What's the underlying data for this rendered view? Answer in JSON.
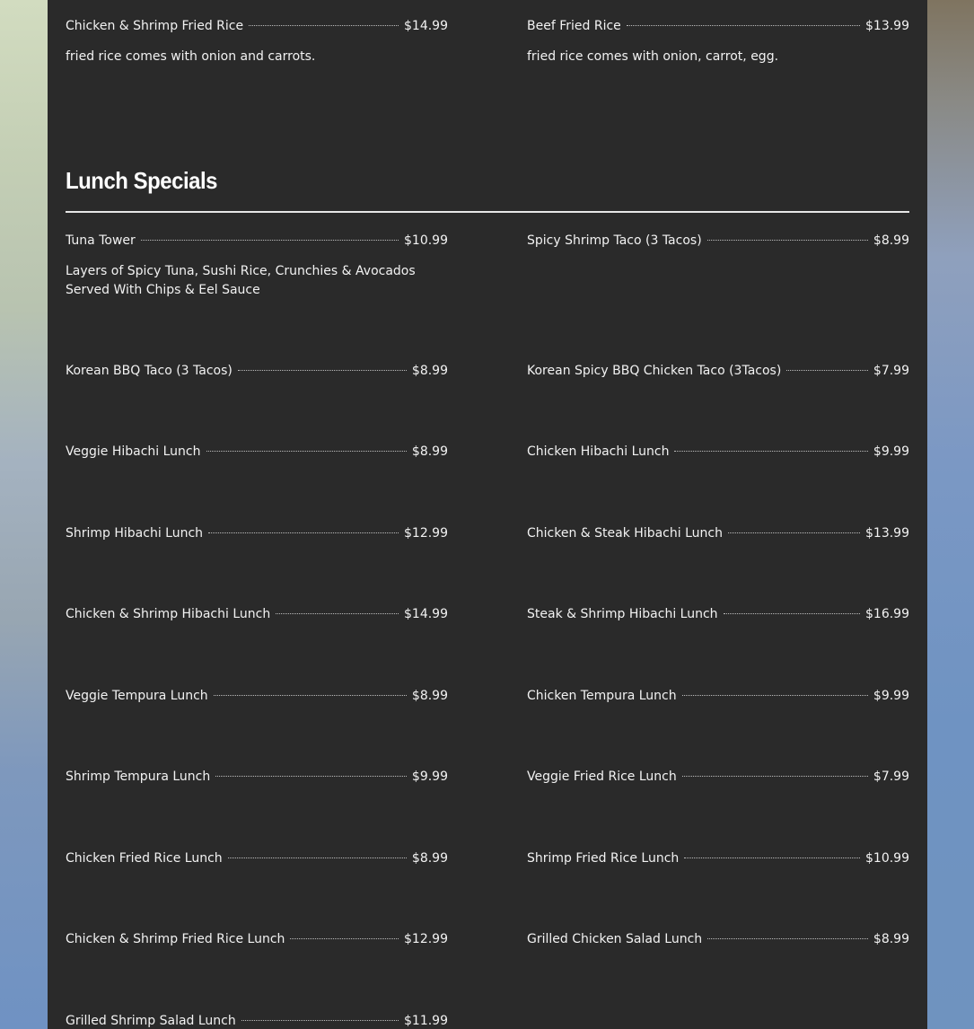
{
  "top_items": [
    {
      "name": "Chicken & Shrimp Fried Rice",
      "price": "$14.99",
      "desc": "fried rice comes with onion and carrots."
    },
    {
      "name": "Beef Fried Rice",
      "price": "$13.99",
      "desc": "fried rice comes with onion, carrot, egg."
    }
  ],
  "section": {
    "title": "Lunch Specials"
  },
  "lunch": [
    {
      "name": "Tuna Tower",
      "price": "$10.99",
      "desc": "Layers of Spicy Tuna, Sushi Rice, Crunchies & Avocados Served With Chips & Eel Sauce"
    },
    {
      "name": "Spicy Shrimp Taco (3 Tacos)",
      "price": "$8.99"
    },
    {
      "name": "Korean BBQ Taco (3 Tacos)",
      "price": "$8.99"
    },
    {
      "name": "Korean Spicy BBQ Chicken Taco (3Tacos)",
      "price": "$7.99"
    },
    {
      "name": "Veggie Hibachi Lunch",
      "price": "$8.99"
    },
    {
      "name": "Chicken Hibachi Lunch",
      "price": "$9.99"
    },
    {
      "name": "Shrimp Hibachi Lunch",
      "price": "$12.99"
    },
    {
      "name": "Chicken & Steak Hibachi Lunch",
      "price": "$13.99"
    },
    {
      "name": "Chicken & Shrimp Hibachi Lunch",
      "price": "$14.99"
    },
    {
      "name": "Steak & Shrimp Hibachi Lunch",
      "price": "$16.99"
    },
    {
      "name": "Veggie Tempura Lunch",
      "price": "$8.99"
    },
    {
      "name": "Chicken Tempura Lunch",
      "price": "$9.99"
    },
    {
      "name": "Shrimp Tempura Lunch",
      "price": "$9.99"
    },
    {
      "name": "Veggie Fried Rice Lunch",
      "price": "$7.99"
    },
    {
      "name": "Chicken Fried Rice Lunch",
      "price": "$8.99"
    },
    {
      "name": "Shrimp Fried Rice Lunch",
      "price": "$10.99"
    },
    {
      "name": "Chicken & Shrimp Fried Rice Lunch",
      "price": "$12.99"
    },
    {
      "name": "Grilled Chicken Salad Lunch",
      "price": "$8.99"
    },
    {
      "name": "Grilled Shrimp Salad Lunch",
      "price": "$11.99"
    }
  ]
}
